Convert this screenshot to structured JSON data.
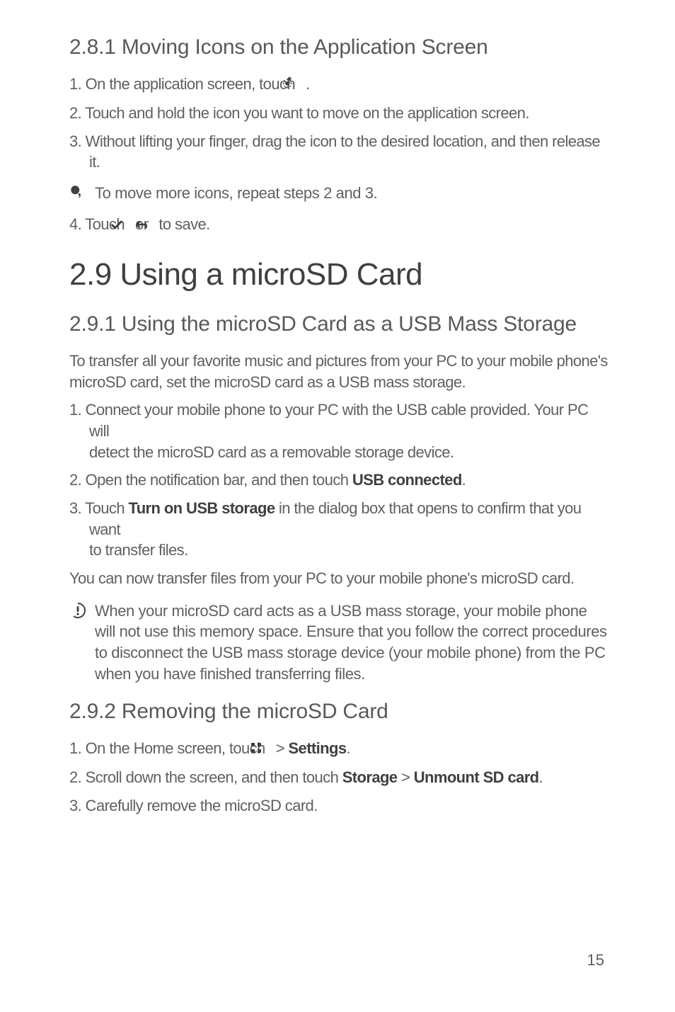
{
  "s281": {
    "heading": "2.8.1  Moving Icons on the Application Screen",
    "step1_pre": "1. On the application screen, touch ",
    "step1_post": " .",
    "step2": "2. Touch and hold the icon you want to move on the application screen.",
    "step3": "3. Without lifting your finger, drag the icon to the desired location, and then release it.",
    "tip": "To move more icons, repeat steps 2 and 3.",
    "step4_pre": "4. Touch ",
    "step4_mid": " or ",
    "step4_post": " to save."
  },
  "s29": {
    "heading": "2.9  Using a microSD Card"
  },
  "s291": {
    "heading": "2.9.1  Using the microSD Card as a USB Mass Storage",
    "intro": "To transfer all your favorite music and pictures from your PC to your mobile phone's microSD card, set the microSD card as a USB mass storage.",
    "step1_a": "1. Connect your mobile phone to your PC with the USB cable provided. Your PC will",
    "step1_b": "detect the microSD card as a removable storage device.",
    "step2_pre": "2. Open the notification bar, and then touch ",
    "step2_bold": "USB connected",
    "step2_post": ".",
    "step3_pre": "3. Touch ",
    "step3_bold": "Turn on USB storage",
    "step3_mid_a": " in the dialog box that opens to confirm that you want",
    "step3_b": "to transfer files.",
    "after": "You can now transfer files from your PC to your mobile phone's microSD card.",
    "caution": "When your microSD card acts as a USB mass storage, your mobile phone will not use this memory space. Ensure that you follow the correct procedures to disconnect the USB mass storage device (your mobile phone) from the PC when you have finished transferring files."
  },
  "s292": {
    "heading": "2.9.2  Removing the microSD Card",
    "step1_pre": "1. On the Home screen, touch ",
    "step1_mid": "  > ",
    "step1_bold": "Settings",
    "step1_post": ".",
    "step2_pre": "2. Scroll down the screen, and then touch ",
    "step2_b1": "Storage",
    "step2_mid": " > ",
    "step2_b2": "Unmount SD card",
    "step2_post": ".",
    "step3": "3. Carefully remove the microSD card."
  },
  "pagenum": "15",
  "icons": {
    "gear": "gear-spark-icon",
    "check": "check-icon",
    "back": "back-arrow-icon",
    "tip": "tip-bubble-icon",
    "caution": "caution-circle-icon",
    "apps": "apps-grid-icon"
  }
}
